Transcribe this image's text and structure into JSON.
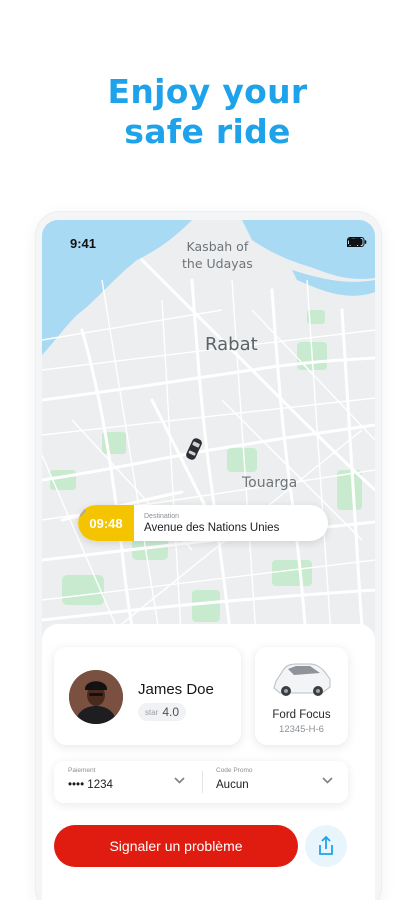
{
  "promo": {
    "headline_line1": "Enjoy your",
    "headline_line2": "safe ride",
    "headline_color": "#1ea3ea"
  },
  "status_bar": {
    "time": "9:41",
    "icons": [
      "signal-icon",
      "wifi-icon",
      "battery-icon"
    ]
  },
  "map": {
    "labels": {
      "kasbah_line1": "Kasbah of",
      "kasbah_line2": "the Udayas",
      "city": "Rabat",
      "district": "Touarga"
    },
    "marker_icon": "car-icon",
    "colors": {
      "water": "#a9daf3",
      "land": "#eceeef",
      "parks": "#c8ebd0",
      "roads": "#ffffff"
    }
  },
  "destination": {
    "eta": "09:48",
    "caption": "Destination",
    "address": "Avenue des Nations Unies",
    "eta_color": "#f5c400"
  },
  "driver": {
    "name": "James Doe",
    "rating_label": "star",
    "rating": "4.0"
  },
  "vehicle": {
    "model": "Ford Focus",
    "plate": "12345-H-6"
  },
  "payment": {
    "caption": "Paiement",
    "value": "•••• 1234"
  },
  "promo_code": {
    "caption": "Code Promo",
    "value": "Aucun"
  },
  "actions": {
    "report_label": "Signaler un problème",
    "report_color": "#e01b10",
    "share_icon": "share-icon"
  }
}
